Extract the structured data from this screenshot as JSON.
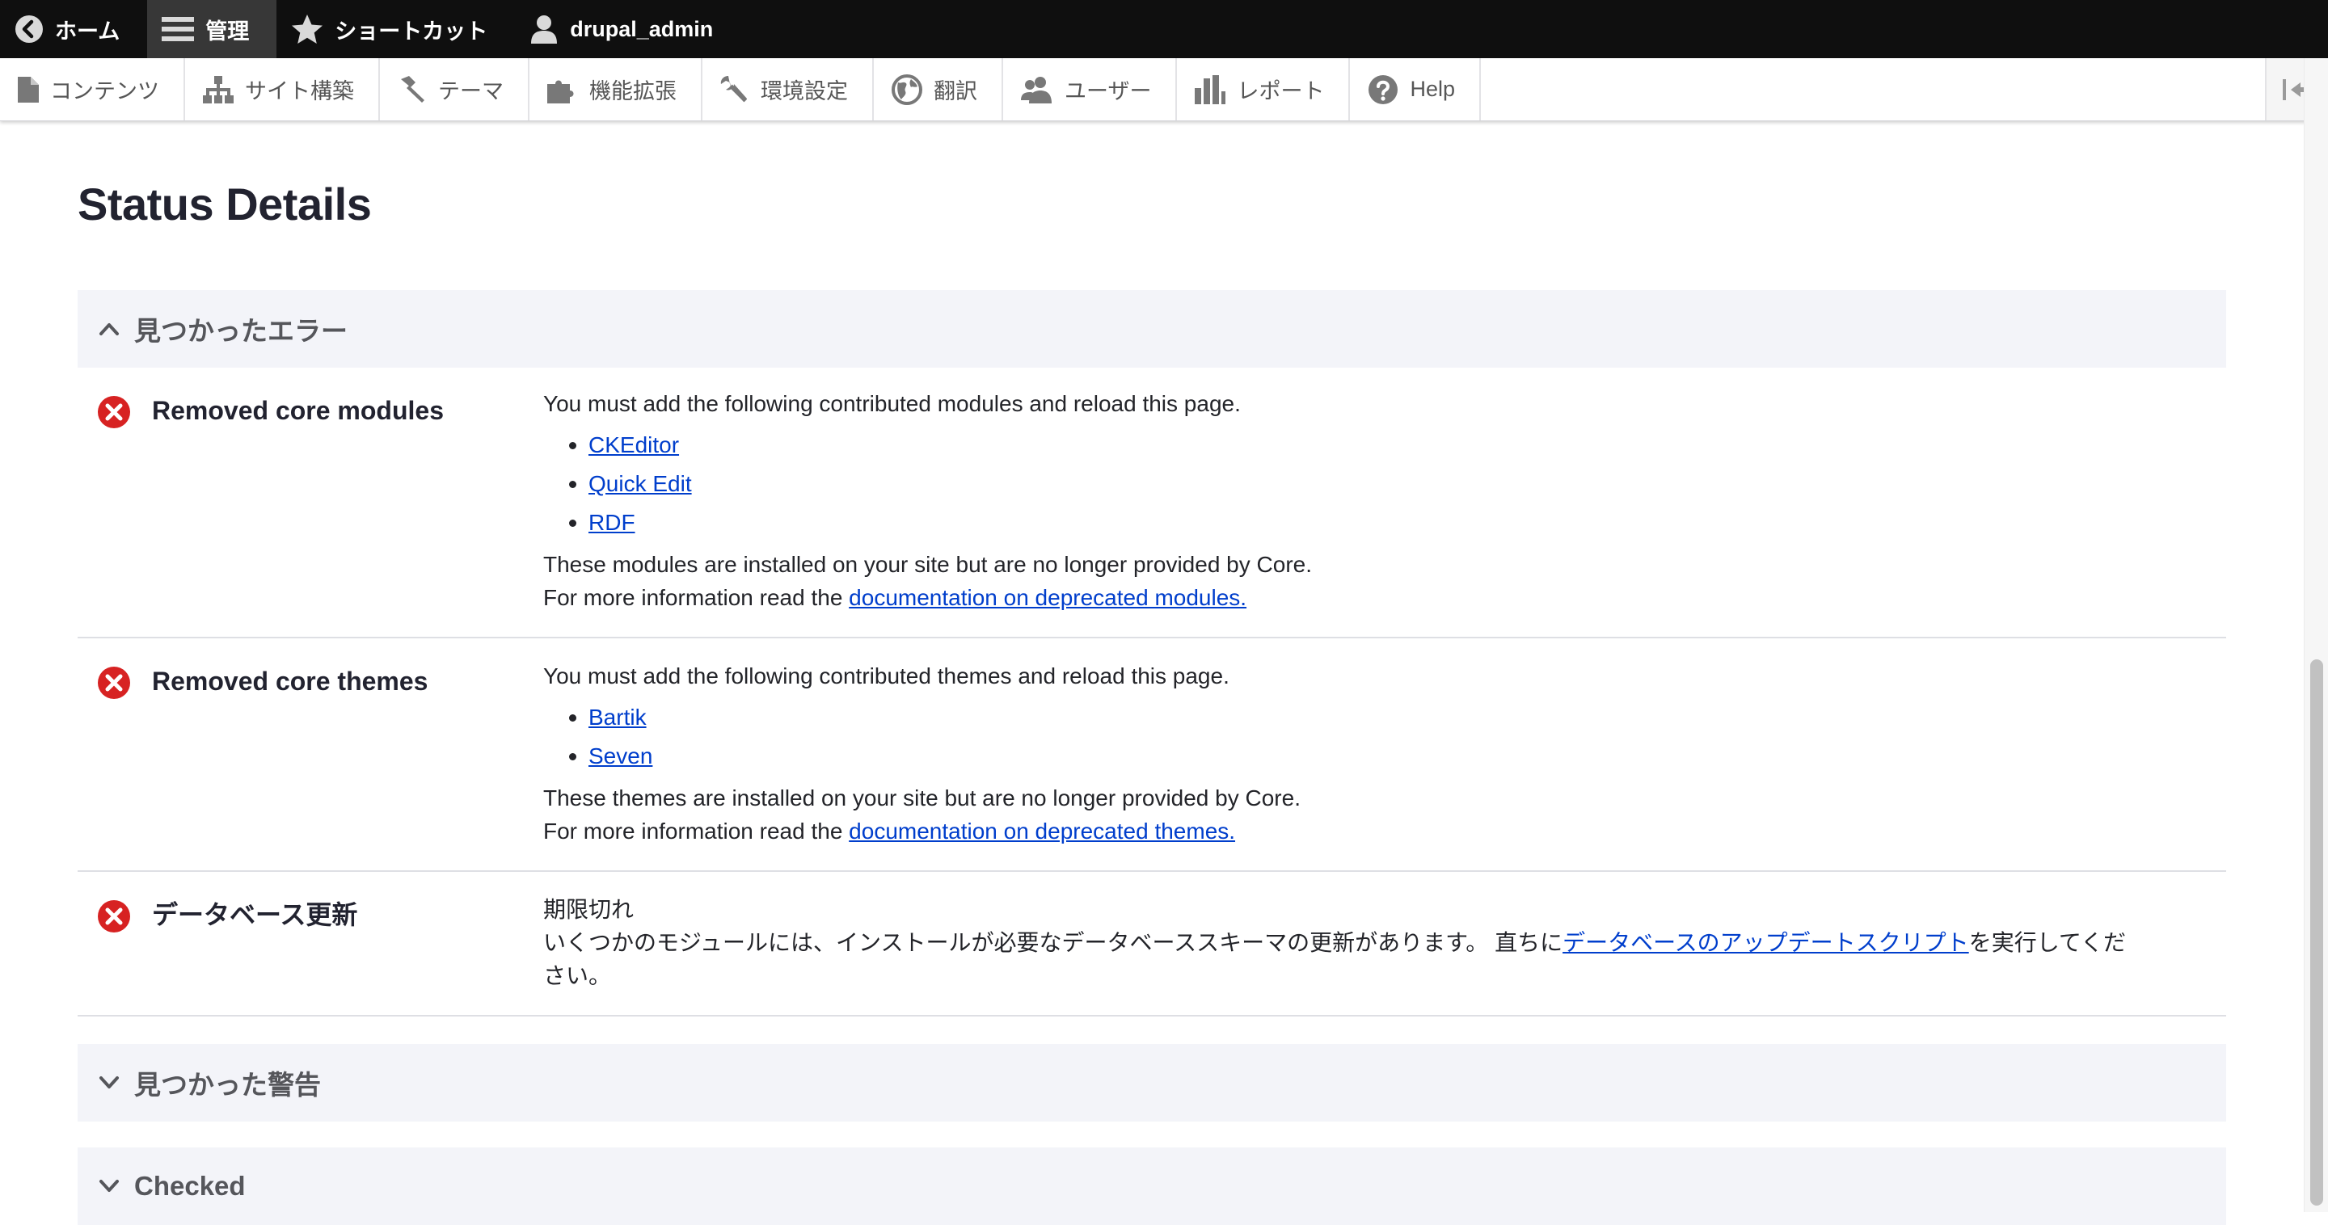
{
  "toolbar": {
    "items": [
      {
        "label": "ホーム",
        "icon": "back-arrow-icon"
      },
      {
        "label": "管理",
        "icon": "hamburger-menu-icon"
      },
      {
        "label": "ショートカット",
        "icon": "star-icon"
      },
      {
        "label": "drupal_admin",
        "icon": "user-icon"
      }
    ]
  },
  "tray": {
    "items": [
      {
        "label": "コンテンツ",
        "icon": "file-icon"
      },
      {
        "label": "サイト構築",
        "icon": "structure-icon"
      },
      {
        "label": "テーマ",
        "icon": "paintbrush-icon"
      },
      {
        "label": "機能拡張",
        "icon": "puzzle-icon"
      },
      {
        "label": "環境設定",
        "icon": "wrench-icon"
      },
      {
        "label": "翻訳",
        "icon": "globe-icon"
      },
      {
        "label": "ユーザー",
        "icon": "people-icon"
      },
      {
        "label": "レポート",
        "icon": "bar-chart-icon"
      },
      {
        "label": "Help",
        "icon": "help-icon"
      }
    ]
  },
  "page": {
    "title": "Status Details"
  },
  "sections": {
    "errors": {
      "label": "見つかったエラー",
      "expanded": true
    },
    "warnings": {
      "label": "見つかった警告",
      "expanded": false
    },
    "checked": {
      "label": "Checked",
      "expanded": false
    }
  },
  "errors": [
    {
      "title": "Removed core modules",
      "intro": "You must add the following contributed modules and reload this page.",
      "links": [
        "CKEditor",
        "Quick Edit",
        "RDF"
      ],
      "note": "These modules are installed on your site but are no longer provided by Core.",
      "more_prefix": "For more information read the ",
      "more_link": "documentation on deprecated modules."
    },
    {
      "title": "Removed core themes",
      "intro": "You must add the following contributed themes and reload this page.",
      "links": [
        "Bartik",
        "Seven"
      ],
      "note": "These themes are installed on your site but are no longer provided by Core.",
      "more_prefix": "For more information read the ",
      "more_link": "documentation on deprecated themes."
    },
    {
      "title": "データベース更新",
      "value": "期限切れ",
      "desc_prefix": "いくつかのモジュールには、インストールが必要なデータベーススキーマの更新があります。 直ちに",
      "desc_link": "データベースのアップデートスクリプト",
      "desc_suffix": "を実行してください。"
    }
  ],
  "colors": {
    "toolbar_bg": "#0f0f0f",
    "toolbar_active": "#373737",
    "section_bg": "#f3f4f9",
    "error_red": "#d72222",
    "link": "#003ecc"
  }
}
